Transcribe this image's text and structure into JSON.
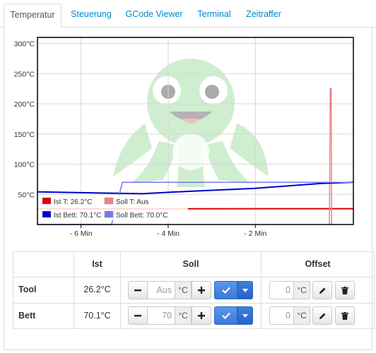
{
  "tabs": [
    {
      "label": "Temperatur",
      "active": true
    },
    {
      "label": "Steuerung",
      "active": false
    },
    {
      "label": "GCode Viewer",
      "active": false
    },
    {
      "label": "Terminal",
      "active": false
    },
    {
      "label": "Zeitraffer",
      "active": false
    }
  ],
  "chart_data": {
    "type": "line",
    "x_unit": "min",
    "xlim": [
      -7.0,
      0.25
    ],
    "ylim": [
      0,
      310
    ],
    "y_ticks": [
      50,
      100,
      150,
      200,
      250,
      300
    ],
    "y_tick_labels": [
      "50°C",
      "100°C",
      "150°C",
      "200°C",
      "250°C",
      "300°C"
    ],
    "x_ticks": [
      -6,
      -4,
      -2
    ],
    "x_tick_labels": [
      "- 6 Min",
      "- 4 Min",
      "- 2 Min"
    ],
    "grid": true,
    "legend_position": "bottom-left",
    "series": [
      {
        "name": "Ist T: 26.2°C",
        "color": "#dd0000",
        "width": 2,
        "x": [
          -7.0,
          -0.2,
          0.25
        ],
        "y": [
          26,
          26.2,
          26.2
        ]
      },
      {
        "name": "Soll T: Aus",
        "color": "#f08080",
        "width": 1.5,
        "x": [
          -0.3,
          -0.28,
          -0.26,
          -0.25,
          -0.24
        ],
        "y": [
          0,
          225,
          225,
          0,
          0
        ]
      },
      {
        "name": "Ist Bett: 70.1°C",
        "color": "#0000cc",
        "width": 2,
        "x": [
          -7.0,
          -4.6,
          -3.8,
          -2.0,
          -0.5,
          0.25
        ],
        "y": [
          54,
          51,
          54,
          60,
          68,
          70.1
        ]
      },
      {
        "name": "Soll Bett: 70.0°C",
        "color": "#7777ee",
        "width": 1.5,
        "x": [
          -7.0,
          -5.3,
          -5.05,
          0.25
        ],
        "y": [
          0,
          0,
          70,
          70
        ]
      }
    ]
  },
  "table": {
    "headers": {
      "name": "",
      "actual": "Ist",
      "target": "Soll",
      "offset": "Offset"
    },
    "rows": [
      {
        "label": "Tool",
        "actual": "26.2°C",
        "target_placeholder": "Aus",
        "target_unit": "°C",
        "offset_placeholder": "0",
        "offset_unit": "°C"
      },
      {
        "label": "Bett",
        "actual": "70.1°C",
        "target_placeholder": "70",
        "target_unit": "°C",
        "offset_placeholder": "0",
        "offset_unit": "°C"
      }
    ]
  },
  "icons": {
    "decrement": "minus-icon",
    "increment": "plus-icon",
    "confirm": "check-icon",
    "dropdown": "caret-down-icon",
    "edit": "pencil-icon",
    "delete": "trash-icon",
    "watermark": "octopus-logo"
  },
  "colors": {
    "link": "#0088cc",
    "primary_button": "#3a7ad8",
    "watermark": "#8fd18f"
  }
}
